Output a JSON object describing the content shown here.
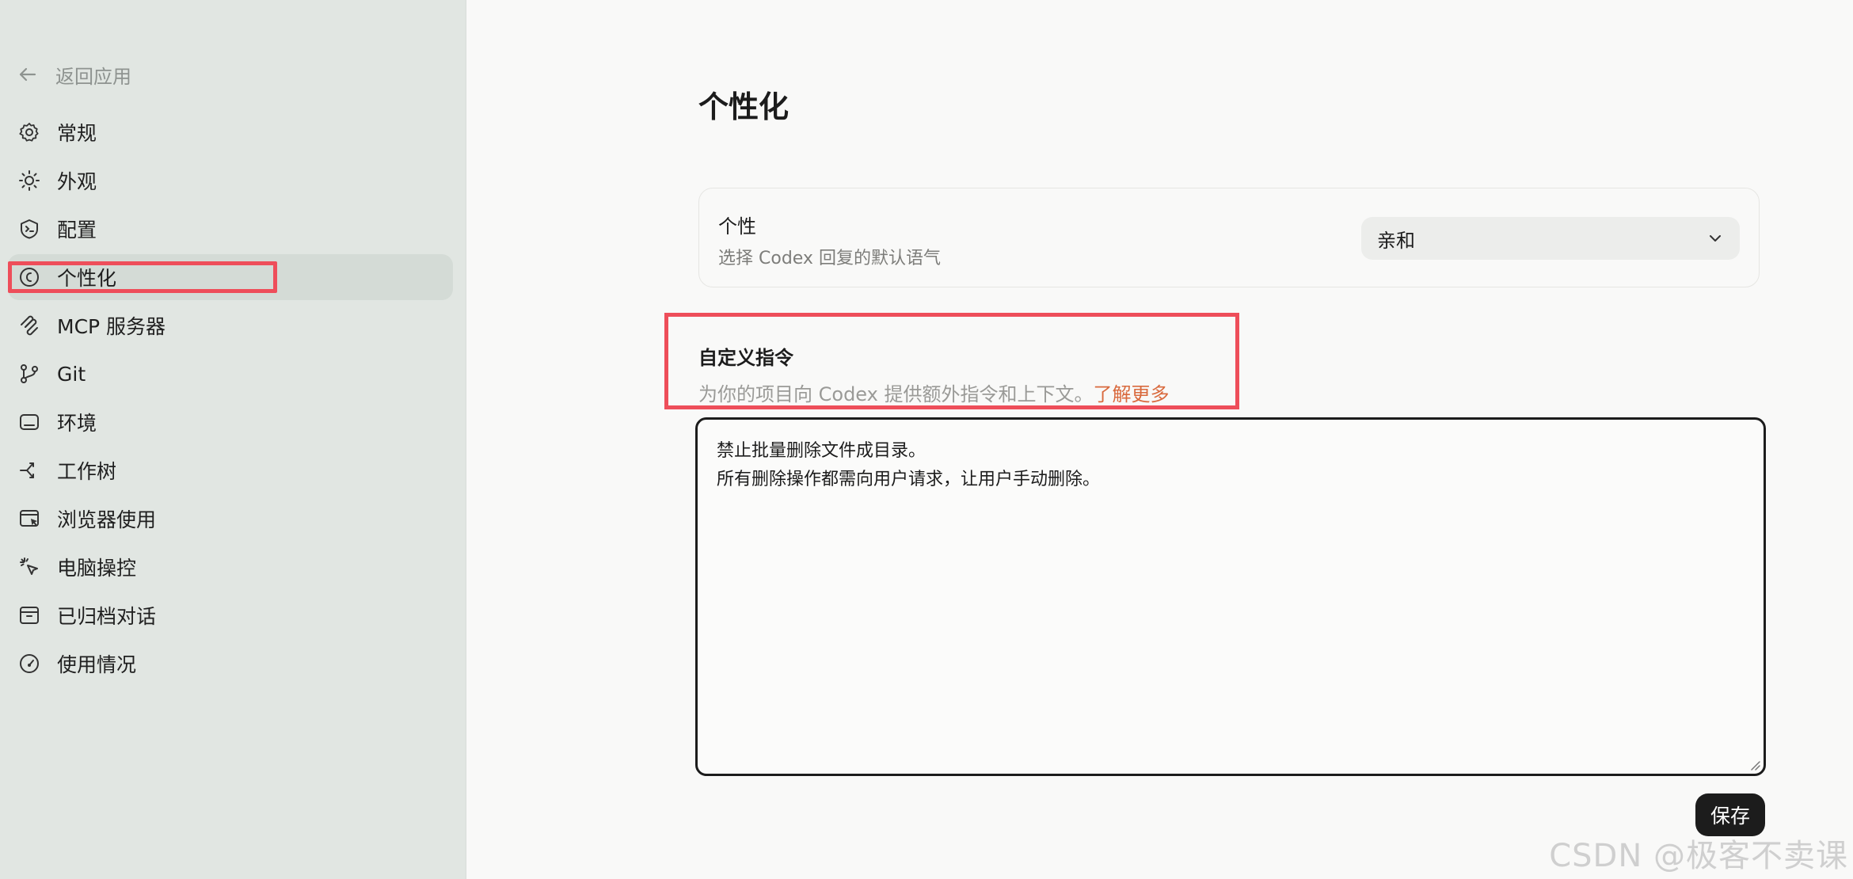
{
  "sidebar": {
    "back_label": "返回应用",
    "items": [
      {
        "label": "常规",
        "icon": "gear-icon"
      },
      {
        "label": "外观",
        "icon": "sun-icon"
      },
      {
        "label": "配置",
        "icon": "shield-terminal-icon"
      },
      {
        "label": "个性化",
        "icon": "personalization-icon",
        "active": true
      },
      {
        "label": "MCP 服务器",
        "icon": "mcp-icon"
      },
      {
        "label": "Git",
        "icon": "git-branch-icon"
      },
      {
        "label": "环境",
        "icon": "environment-icon"
      },
      {
        "label": "工作树",
        "icon": "worktree-icon"
      },
      {
        "label": "浏览器使用",
        "icon": "browser-icon"
      },
      {
        "label": "电脑操控",
        "icon": "cursor-click-icon"
      },
      {
        "label": "已归档对话",
        "icon": "archive-icon"
      },
      {
        "label": "使用情况",
        "icon": "gauge-icon"
      }
    ]
  },
  "page": {
    "title": "个性化"
  },
  "personality": {
    "label": "个性",
    "description": "选择 Codex 回复的默认语气",
    "selected": "亲和"
  },
  "custom_instructions": {
    "title": "自定义指令",
    "description": "为你的项目向 Codex 提供额外指令和上下文。",
    "learn_more": "了解更多",
    "lines": [
      "禁止批量删除文件成目录。",
      "所有删除操作都需向用户请求，让用户手动删除。"
    ]
  },
  "save_label": "保存",
  "watermark": "CSDN @极客不卖课",
  "colors": {
    "sidebar_bg": "#e1e6e2",
    "highlight_box": "#ee4e5a",
    "link": "#d96a3e",
    "button_bg": "#1c1c1c"
  }
}
